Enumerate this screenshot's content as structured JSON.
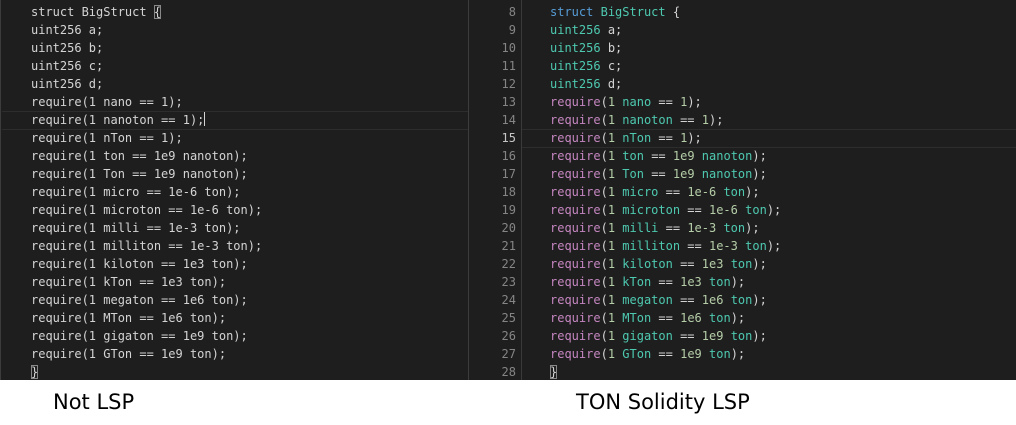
{
  "left": {
    "caption": "Not LSP",
    "lines": [
      "struct BigStruct {",
      "uint256 a;",
      "uint256 b;",
      "uint256 c;",
      "uint256 d;",
      "require(1 nano == 1);",
      "require(1 nanoton == 1);",
      "require(1 nTon == 1);",
      "require(1 ton == 1e9 nanoton);",
      "require(1 Ton == 1e9 nanoton);",
      "require(1 micro == 1e-6 ton);",
      "require(1 microton == 1e-6 ton);",
      "require(1 milli == 1e-3 ton);",
      "require(1 milliton == 1e-3 ton);",
      "require(1 kiloton == 1e3 ton);",
      "require(1 kTon == 1e3 ton);",
      "require(1 megaton == 1e6 ton);",
      "require(1 MTon == 1e6 ton);",
      "require(1 gigaton == 1e9 ton);",
      "require(1 GTon == 1e9 ton);",
      "}"
    ]
  },
  "right": {
    "caption": "TON Solidity LSP",
    "line_numbers": [
      "8",
      "9",
      "10",
      "11",
      "12",
      "13",
      "14",
      "15",
      "16",
      "17",
      "18",
      "19",
      "20",
      "21",
      "22",
      "23",
      "24",
      "25",
      "26",
      "27",
      "28"
    ],
    "active_line": "15"
  },
  "colors": {
    "editor_bg": "#1e1e1e",
    "keyword": "#569cd6",
    "type": "#4ec9b0",
    "function": "#c586c0",
    "number": "#b5cea8",
    "plain": "#d4d4d4",
    "line_number": "#858585"
  }
}
